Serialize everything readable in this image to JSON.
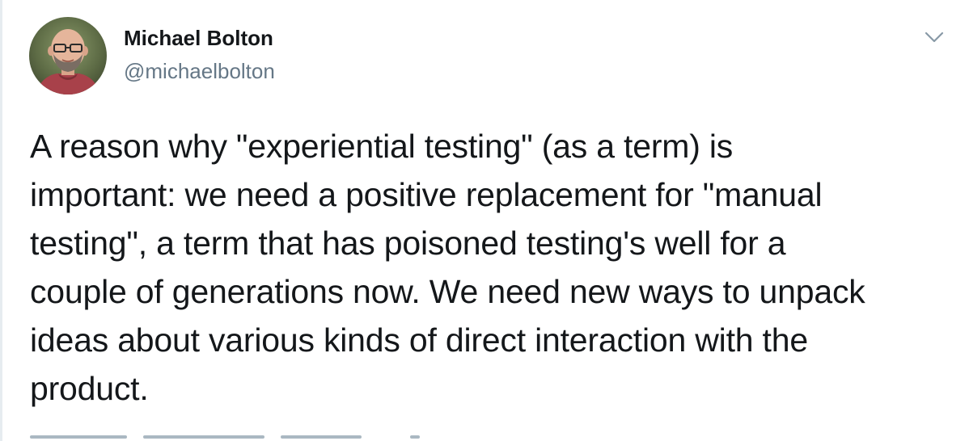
{
  "author": {
    "display_name": "Michael Bolton",
    "handle": "@michaelbolton",
    "avatar_icon": "profile-photo"
  },
  "menu": {
    "icon": "chevron-down-icon"
  },
  "tweet": {
    "text": "A reason why \"experiential testing\" (as a term) is\nimportant: we need a positive replacement for \"manual\ntesting\", a term that has poisoned testing's well for a\ncouple of generations now. We need new ways to unpack\nideas about various kinds of direct interaction with the\nproduct."
  },
  "colors": {
    "text_primary": "#14171a",
    "text_secondary": "#657786",
    "chevron": "#8899a6"
  }
}
